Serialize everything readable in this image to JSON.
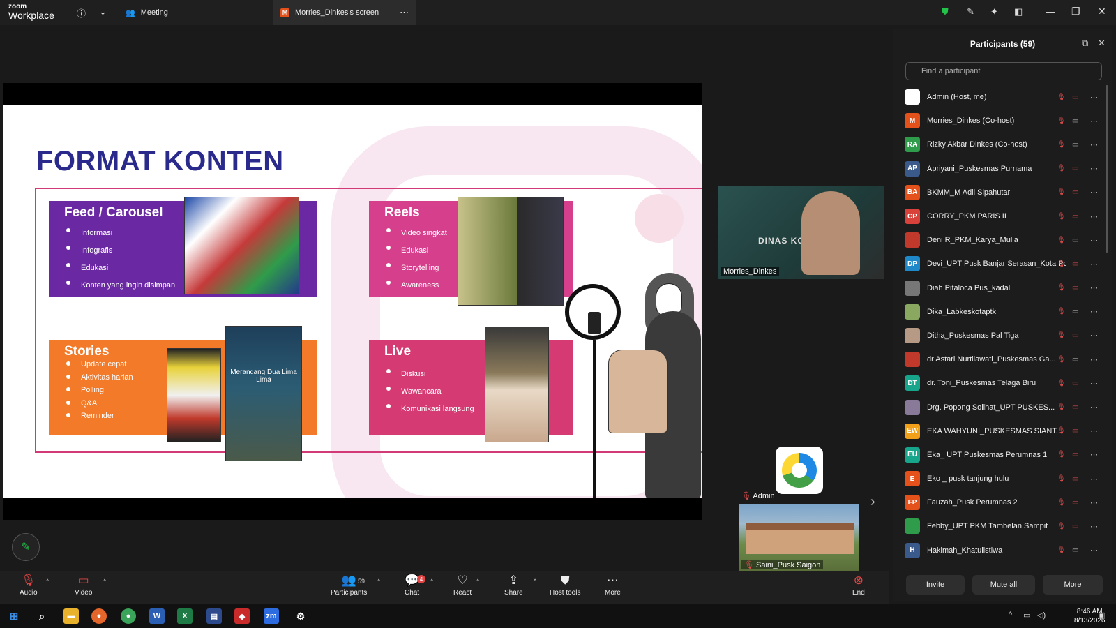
{
  "app": {
    "brand_small": "zoom",
    "brand_big": "Workplace",
    "meeting_tab": "Meeting",
    "screen_tab_badge": "M",
    "screen_tab": "Morries_Dinkes's screen"
  },
  "slide": {
    "title": "FORMAT KONTEN",
    "feed": {
      "title": "Feed / Carousel",
      "items": [
        "Informasi",
        "Infografis",
        "Edukasi",
        "Konten yang ingin disimpan"
      ]
    },
    "reels": {
      "title": "Reels",
      "items": [
        "Video singkat",
        "Edukasi",
        "Storytelling",
        "Awareness"
      ]
    },
    "stories": {
      "title": "Stories",
      "items": [
        "Update cepat",
        "Aktivitas harian",
        "Polling",
        "Q&A",
        "Reminder"
      ]
    },
    "live": {
      "title": "Live",
      "items": [
        "Diskusi",
        "Wawancara",
        "Komunikasi langsung"
      ]
    },
    "stories_thumb2_text": "Merancang Dua Lima Lima",
    "colors": {
      "feed": "#6a29a3",
      "reels": "#d63f8c",
      "stories": "#f27a28",
      "live": "#d63a72",
      "title": "#2a2a8c"
    }
  },
  "video": {
    "speaker_name": "Morries_Dinkes",
    "speaker_bg_text": "DINAS KO",
    "admin_label": "Admin",
    "saini_label": "Saini_Pusk Saigon"
  },
  "panel": {
    "title": "Participants (59)",
    "search_placeholder": "Find a participant",
    "participants": [
      {
        "initials": "",
        "name": "Admin (Host, me)",
        "color": "#ffffff",
        "video": "off"
      },
      {
        "initials": "M",
        "name": "Morries_Dinkes (Co-host)",
        "color": "#e5511a",
        "video": "on"
      },
      {
        "initials": "RA",
        "name": "Rizky Akbar Dinkes (Co-host)",
        "color": "#2e9c4a",
        "video": "on"
      },
      {
        "initials": "AP",
        "name": "Apriyani_Puskesmas Purnama",
        "color": "#3a5a8c",
        "video": "off"
      },
      {
        "initials": "BA",
        "name": "BKMM_M Adil Sipahutar",
        "color": "#e5511a",
        "video": "off"
      },
      {
        "initials": "CP",
        "name": "CORRY_PKM PARIS II",
        "color": "#d9423a",
        "video": "off"
      },
      {
        "initials": "",
        "name": "Deni R_PKM_Karya_Mulia",
        "color": "#c0392b",
        "video": "on"
      },
      {
        "initials": "DP",
        "name": "Devi_UPT Pusk Banjar Serasan_Kota Pon...",
        "color": "#1e88c8",
        "video": "off"
      },
      {
        "initials": "",
        "name": "Diah Pitaloca Pus_kadal",
        "color": "#777777",
        "video": "off"
      },
      {
        "initials": "",
        "name": "Dika_Labkeskotaptk",
        "color": "#8aa860",
        "video": "on"
      },
      {
        "initials": "",
        "name": "Ditha_Puskesmas Pal Tiga",
        "color": "#b79a86",
        "video": "off"
      },
      {
        "initials": "",
        "name": "dr Astari Nurtilawati_Puskesmas Ga...",
        "color": "#c0392b",
        "video": "on"
      },
      {
        "initials": "DT",
        "name": "dr. Toni_Puskesmas Telaga Biru",
        "color": "#17a58c",
        "video": "off"
      },
      {
        "initials": "",
        "name": "Drg. Popong Solihat_UPT PUSKES...",
        "color": "#8a7a9a",
        "video": "off"
      },
      {
        "initials": "EW",
        "name": "EKA WAHYUNI_PUSKESMAS SIANT...",
        "color": "#f2a01a",
        "video": "off"
      },
      {
        "initials": "EU",
        "name": "Eka_ UPT Puskesmas Perumnas 1",
        "color": "#17a58c",
        "video": "off"
      },
      {
        "initials": "E",
        "name": "Eko _ pusk tanjung hulu",
        "color": "#e5511a",
        "video": "off"
      },
      {
        "initials": "FP",
        "name": "Fauzah_Pusk Perumnas 2",
        "color": "#e5511a",
        "video": "off"
      },
      {
        "initials": "",
        "name": "Febby_UPT PKM Tambelan Sampit",
        "color": "#2e9c4a",
        "video": "off"
      },
      {
        "initials": "H",
        "name": "Hakimah_Khatulistiwa",
        "color": "#3a5a8c",
        "video": "on"
      }
    ],
    "buttons": {
      "invite": "Invite",
      "mute_all": "Mute all",
      "more": "More"
    }
  },
  "toolbar": {
    "audio": "Audio",
    "video": "Video",
    "participants": "Participants",
    "participants_count": "59",
    "chat": "Chat",
    "chat_badge": "4",
    "react": "React",
    "share": "Share",
    "host_tools": "Host tools",
    "more": "More",
    "end": "End"
  },
  "taskbar": {
    "time": "8:46 AM",
    "date": "8/13/2026"
  }
}
